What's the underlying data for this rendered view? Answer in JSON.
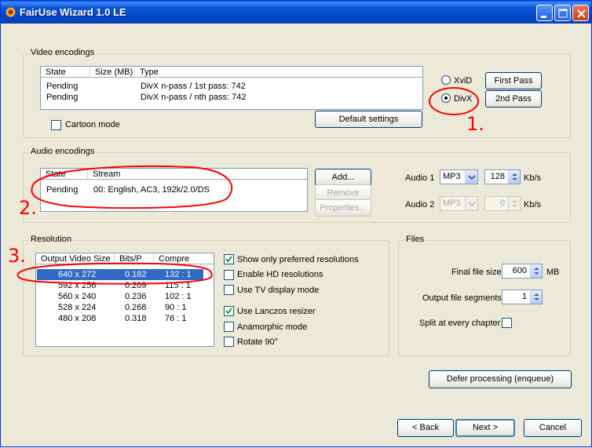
{
  "window": {
    "title": "FairUse Wizard 1.0 LE",
    "controls": {
      "minimize_icon": "minimize-icon",
      "maximize_icon": "maximize-icon",
      "close_icon": "close-icon"
    }
  },
  "video": {
    "group_label": "Video encodings",
    "columns": [
      "State",
      "Size (MB)",
      "Type"
    ],
    "rows": [
      {
        "state": "Pending",
        "size": "",
        "type": "DivX n-pass / 1st pass: 742"
      },
      {
        "state": "Pending",
        "size": "",
        "type": "DivX n-pass / nth pass: 742"
      }
    ],
    "cartoon_mode_label": "Cartoon mode",
    "cartoon_mode_checked": false,
    "default_settings_label": "Default settings",
    "codec_xvid": "XviD",
    "codec_divx": "DivX",
    "codec_selected": "DivX",
    "first_pass_label": "First Pass",
    "second_pass_label": "2nd Pass"
  },
  "audio": {
    "group_label": "Audio encodings",
    "columns": [
      "State",
      "Stream"
    ],
    "rows": [
      {
        "state": "Pending",
        "stream": "00: English, AC3, 192k/2.0/DS"
      }
    ],
    "add_label": "Add...",
    "remove_label": "Remove",
    "properties_label": "Properties...",
    "audio1_label": "Audio 1",
    "audio1_codec": "MP3",
    "audio1_bitrate": "128",
    "audio1_unit": "Kb/s",
    "audio2_label": "Audio 2",
    "audio2_codec": "MP3",
    "audio2_bitrate": "0",
    "audio2_unit": "Kb/s"
  },
  "resolution": {
    "group_label": "Resolution",
    "columns": [
      "Output Video Size",
      "Bits/P",
      "Compre"
    ],
    "rows": [
      {
        "size": "640 x 272",
        "bits": "0.182",
        "compre": "132 : 1",
        "selected": true
      },
      {
        "size": "592 x 256",
        "bits": "0.209",
        "compre": "115 : 1",
        "selected": false
      },
      {
        "size": "560 x 240",
        "bits": "0.236",
        "compre": "102 : 1",
        "selected": false
      },
      {
        "size": "528 x 224",
        "bits": "0.268",
        "compre": "90 : 1",
        "selected": false
      },
      {
        "size": "480 x 208",
        "bits": "0.318",
        "compre": "76 : 1",
        "selected": false
      }
    ],
    "options": [
      {
        "label": "Show only preferred resolutions",
        "checked": true
      },
      {
        "label": "Enable HD resolutions",
        "checked": false
      },
      {
        "label": "Use TV display mode",
        "checked": false
      },
      {
        "label": "Use Lanczos resizer",
        "checked": true
      },
      {
        "label": "Anamorphic mode",
        "checked": false
      },
      {
        "label": "Rotate 90°",
        "checked": false
      }
    ]
  },
  "files": {
    "group_label": "Files",
    "final_size_label": "Final file size",
    "final_size_value": "600",
    "final_size_unit": "MB",
    "segments_label": "Output file segments",
    "segments_value": "1",
    "split_label": "Split at every chapter",
    "split_checked": false
  },
  "defer_label": "Defer processing (enqueue)",
  "nav": {
    "back_label": "< Back",
    "next_label": "Next >",
    "cancel_label": "Cancel"
  },
  "annotations": {
    "one": "1.",
    "two": "2.",
    "three": "3.",
    "color": "#ff0000"
  }
}
